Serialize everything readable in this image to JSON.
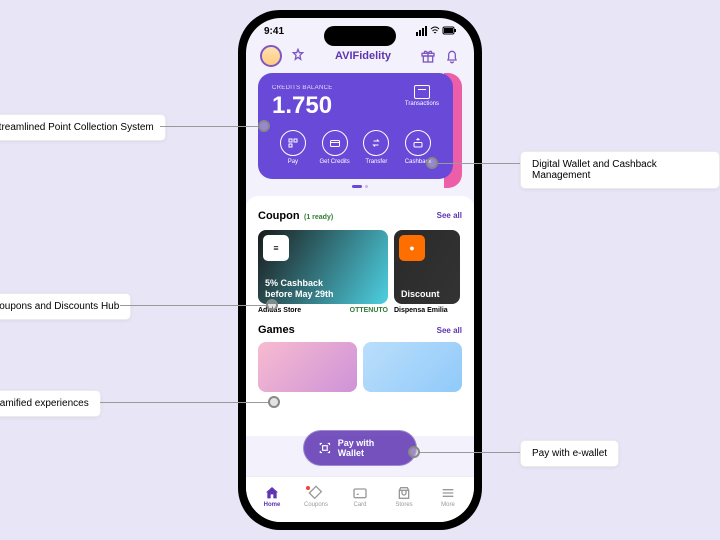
{
  "status": {
    "time": "9:41"
  },
  "header": {
    "title": "AVIFidelity"
  },
  "card": {
    "balance_label": "CREDITS BALANCE",
    "balance_value": "1.750",
    "transactions": "Transactions",
    "actions": [
      {
        "label": "Pay"
      },
      {
        "label": "Get Credits"
      },
      {
        "label": "Transfer"
      },
      {
        "label": "Cashback"
      }
    ]
  },
  "coupon_section": {
    "title": "Coupon",
    "ready": "(1 ready)",
    "see_all": "See all",
    "items": [
      {
        "brand": "adidas",
        "offer_l1": "5% Cashback",
        "offer_l2": "before May 29th",
        "store": "Adidas Store",
        "status": "OTTENUTO"
      },
      {
        "brand": "",
        "offer_l1": "Discount",
        "store": "Dispensa Emilia"
      }
    ]
  },
  "games_section": {
    "title": "Games",
    "see_all": "See all"
  },
  "pay_button": "Pay with Wallet",
  "nav": [
    {
      "label": "Home"
    },
    {
      "label": "Coupons"
    },
    {
      "label": "Card"
    },
    {
      "label": "Stores"
    },
    {
      "label": "More"
    }
  ],
  "annotations": {
    "points": "Streamlined Point Collection System",
    "coupons": "Coupons and Discounts Hub",
    "games": "Gamified experiences",
    "wallet": "Digital Wallet and Cashback Management",
    "pay": "Pay with e-wallet"
  }
}
